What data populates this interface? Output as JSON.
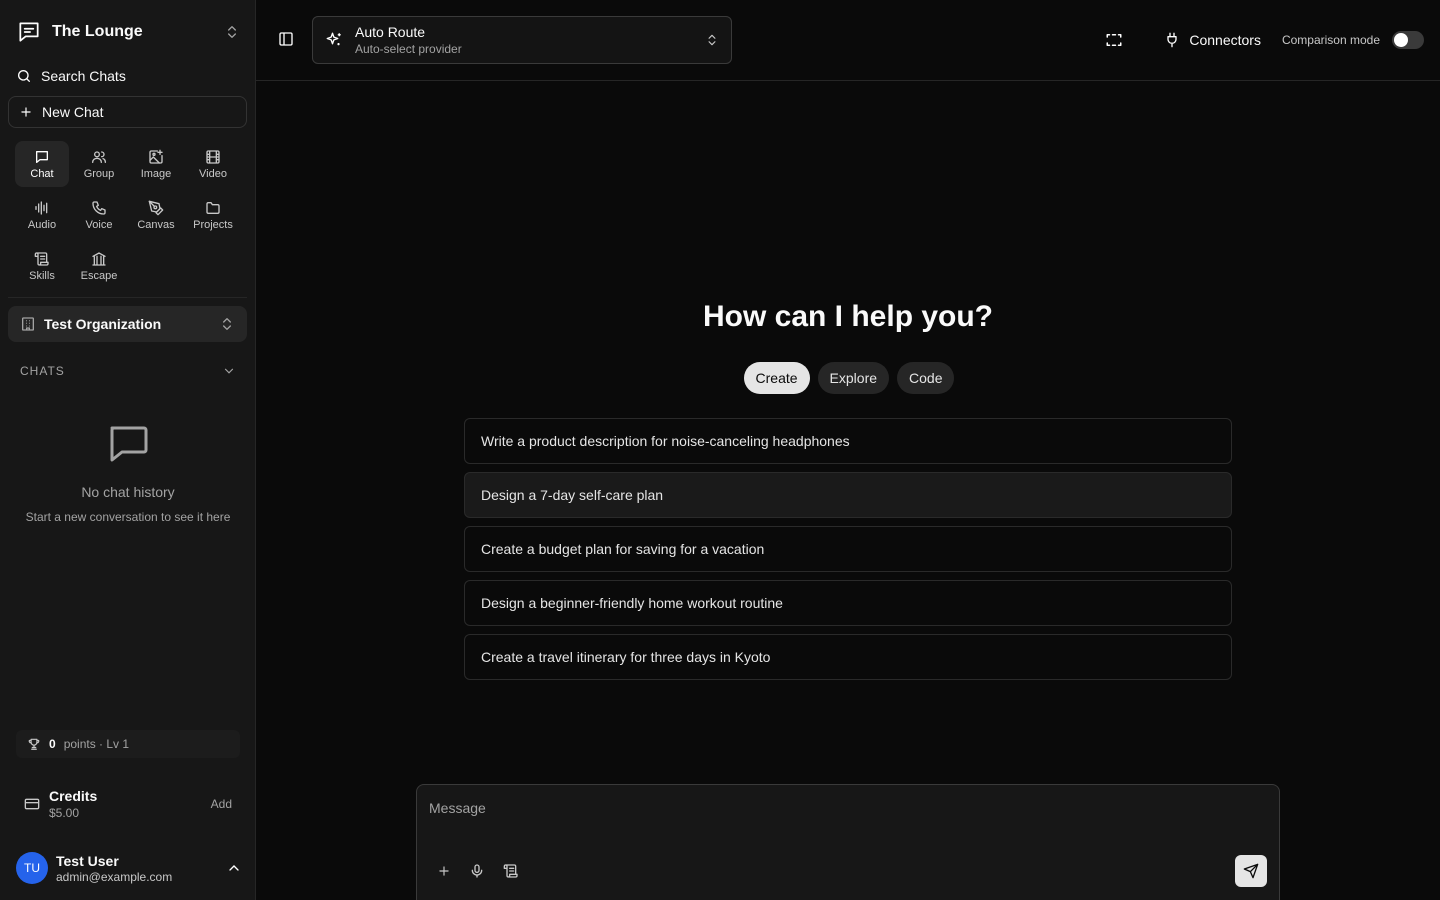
{
  "workspace": {
    "name": "The Lounge"
  },
  "sidebar": {
    "search_label": "Search Chats",
    "new_chat_label": "New Chat",
    "modes": [
      {
        "label": "Chat",
        "icon": "chat-icon",
        "active": true
      },
      {
        "label": "Group",
        "icon": "users-icon"
      },
      {
        "label": "Image",
        "icon": "image-plus-icon"
      },
      {
        "label": "Video",
        "icon": "film-icon"
      },
      {
        "label": "Audio",
        "icon": "audio-lines-icon"
      },
      {
        "label": "Voice",
        "icon": "phone-icon"
      },
      {
        "label": "Canvas",
        "icon": "pen-tool-icon"
      },
      {
        "label": "Projects",
        "icon": "folder-icon"
      },
      {
        "label": "Skills",
        "icon": "scroll-icon"
      },
      {
        "label": "Escape",
        "icon": "landmark-icon"
      }
    ],
    "organization": "Test Organization",
    "chats_header": "CHATS",
    "empty_title": "No chat history",
    "empty_subtitle": "Start a new conversation to see it here",
    "points_value": "0",
    "points_label": "points · Lv 1",
    "credits_label": "Credits",
    "credits_amount": "$5.00",
    "credits_add": "Add",
    "user": {
      "initials": "TU",
      "name": "Test User",
      "email": "admin@example.com"
    }
  },
  "topbar": {
    "model_name": "Auto Route",
    "model_sub": "Auto-select provider",
    "connectors_label": "Connectors",
    "comparison_label": "Comparison mode",
    "comparison_on": false
  },
  "main": {
    "heading": "How can I help you?",
    "tabs": [
      {
        "label": "Create",
        "active": true
      },
      {
        "label": "Explore"
      },
      {
        "label": "Code"
      }
    ],
    "suggestions": [
      "Write a product description for noise-canceling headphones",
      "Design a 7-day self-care plan",
      "Create a budget plan for saving for a vacation",
      "Design a beginner-friendly home workout routine",
      "Create a travel itinerary for three days in Kyoto"
    ]
  },
  "composer": {
    "placeholder": "Message"
  }
}
